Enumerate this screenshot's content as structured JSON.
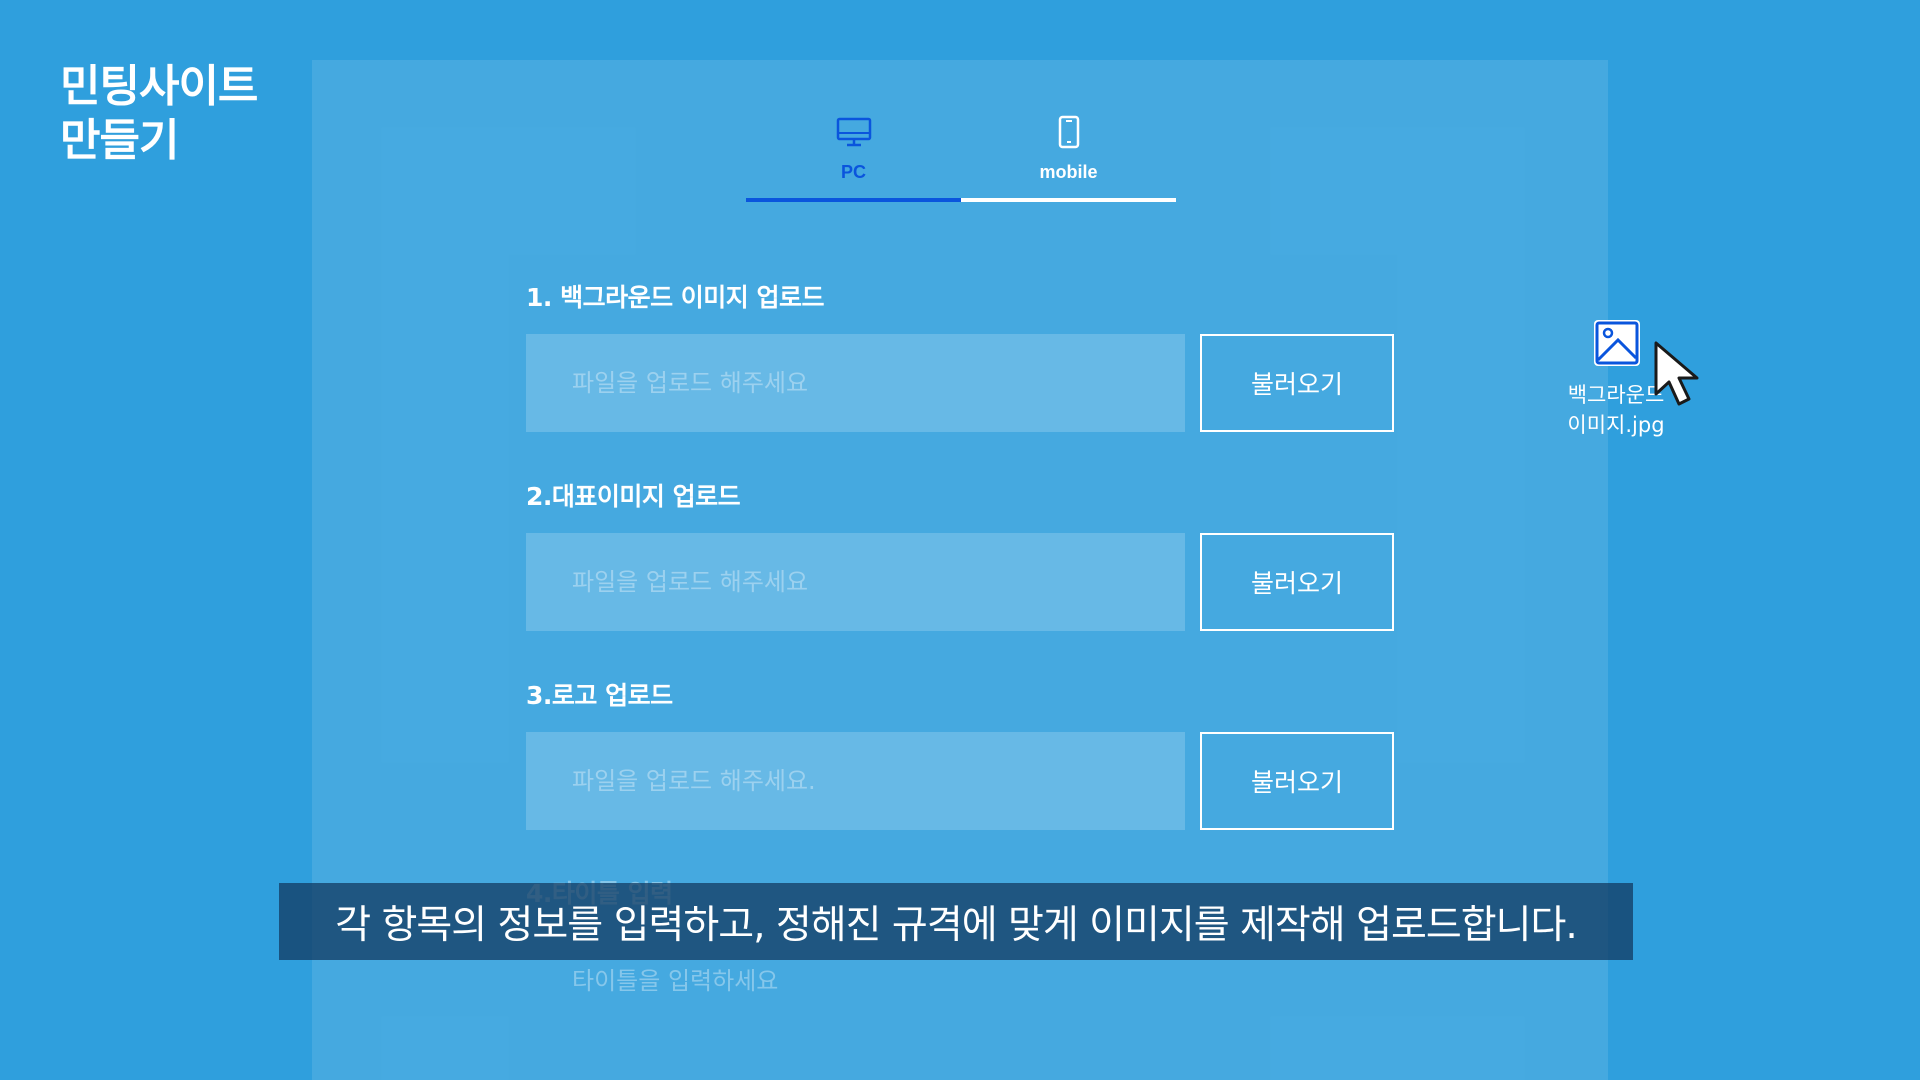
{
  "brand": {
    "line1": "민팅사이트",
    "line2": "만들기"
  },
  "tabs": [
    {
      "label": "PC",
      "icon": "monitor-icon",
      "active": true
    },
    {
      "label": "mobile",
      "icon": "smartphone-icon",
      "active": false
    }
  ],
  "fields": [
    {
      "label": "1. 백그라운드 이미지 업로드",
      "placeholder": "파일을 업로드 해주세요",
      "button": "불러오기"
    },
    {
      "label": "2.대표이미지 업로드",
      "placeholder": "파일을 업로드 해주세요",
      "button": "불러오기"
    },
    {
      "label": "3.로고 업로드",
      "placeholder": "파일을 업로드 해주세요.",
      "button": "불러오기"
    },
    {
      "label": "4.타이틀 입력",
      "placeholder": "타이틀을 입력하세요"
    }
  ],
  "dragged_file": {
    "icon": "image-file-icon",
    "name_line1": "백그라운드",
    "name_line2": "이미지.jpg"
  },
  "cursor_icon": "mouse-pointer-icon",
  "caption": "각 항목의 정보를 입력하고, 정해진 규격에 맞게 이미지를 제작해 업로드합니다.",
  "colors": {
    "background": "#2f9fdd",
    "active_tab": "#0a55dd",
    "input_fill": "#67b9e6",
    "caption_bar": "#11365c"
  }
}
